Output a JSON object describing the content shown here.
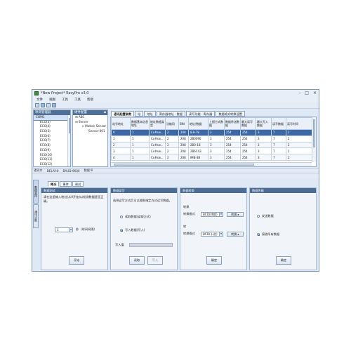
{
  "window": {
    "title": "*New Project* EasyPro v3.0",
    "buttons": [
      "–",
      "□",
      "×"
    ]
  },
  "menu": [
    "文件",
    "视图",
    "工具",
    "工具",
    "帮助"
  ],
  "project_tree": {
    "header": "项目管理器",
    "items": [
      "COM1",
      "ECO(3)",
      "ECO(4)",
      "ECO(5)",
      "ECO(6)",
      "ECO(7)",
      "ECO(8)",
      "ECO(9)",
      "ECO(10)",
      "ECO(11)",
      "ECO(12)"
    ]
  },
  "device_tree": {
    "header": "硬件配置",
    "items": [
      "ABC",
      "Server",
      "Motion Sensor",
      "Sensor-001"
    ]
  },
  "main_tabs": [
    "通讯配置参数",
    "站",
    "地址",
    "寄存器地址 · 数据",
    "读写功能 · 寄存器",
    "数据格式转换设置"
  ],
  "grid": {
    "headers": [
      "站号地址",
      "数据基本信息地址",
      "地址数据类型",
      "功能码",
      "BIN",
      "地址/数据",
      "上报方式数据",
      "数据传送数据",
      "最大读写数据",
      "最大写入数据",
      "读写数据",
      "读写时间"
    ],
    "rows": [
      [
        "0",
        "1",
        "Co#sw...",
        "2",
        "208",
        "IE9-78",
        "3",
        "254",
        "254",
        "3",
        "7",
        "2"
      ],
      [
        "1",
        "1",
        "Co#sw...",
        "2",
        "208",
        "2B0090",
        "3",
        "254",
        "254",
        "3",
        "7",
        "2"
      ],
      [
        "2",
        "1",
        "Co#sw...",
        "2",
        "208",
        "2B0-1B",
        "3",
        "254",
        "254",
        "3",
        "7",
        "2"
      ],
      [
        "3",
        "1",
        "Co#sw...",
        "2",
        "208",
        "2B6C43",
        "3",
        "254",
        "254",
        "3",
        "7",
        "2"
      ],
      [
        "4",
        "1",
        "Co#sw...",
        "2",
        "208",
        "IMB-3B",
        "3",
        "254",
        "254",
        "3",
        "7",
        "2"
      ]
    ]
  },
  "statusbar": [
    "通讯口",
    "DELAY:0",
    "BAUD:9600",
    "数据:8"
  ],
  "bottom_tabs": [
    "概况",
    "事件",
    "调试"
  ],
  "side_tabs": [
    "数据监控",
    "通讯诊断"
  ],
  "sections": {
    "s1": {
      "title": "数据测试",
      "desc": "请在这里输入地址(从0开始)以检测数据是否正确。",
      "value": "1",
      "unit": "秒",
      "unit_note": "(时间间隔)",
      "button": "开始"
    },
    "s2": {
      "title": "数据读写",
      "desc": "选择读写方式后可以按照指定方式读写数据。",
      "opt1": "读取数据(读取方式)",
      "opt2": "写入数据(写入)",
      "field_label": "写入值",
      "btn_start": "读取",
      "btn_stop": "写入"
    },
    "s3": {
      "title": "数据转换",
      "label1": "转换",
      "label1_sub": "转换格式",
      "combo1": "BCD(转换)",
      "btn1": "转换 ▸",
      "label2": "转",
      "label2_sub": "转换格式",
      "combo2": "BCD(十进)",
      "btn2": "转换 ▸",
      "button": "确定"
    },
    "s4": {
      "title": "数据传输",
      "opt1": "发送数据",
      "opt2": "接收所有数据",
      "button": "确定"
    }
  },
  "colors": {
    "accent": "#4d6c93",
    "selection": "#3c68a8",
    "window_bg": "#dfe9f5"
  }
}
